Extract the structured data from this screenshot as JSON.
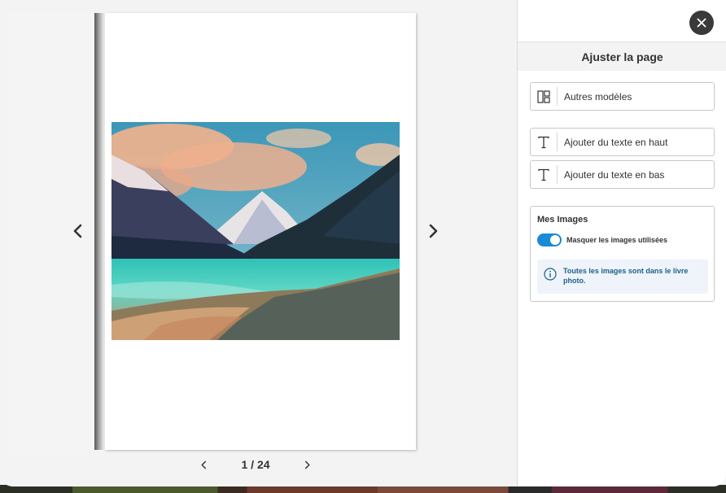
{
  "pager": {
    "current": "1",
    "total": "24",
    "separator": "/"
  },
  "sidebar": {
    "title": "Ajuster la page",
    "options": [
      {
        "label": "Autres modèles",
        "icon": "layout-icon"
      },
      {
        "label": "Ajouter du texte en haut",
        "icon": "text-icon"
      },
      {
        "label": "Ajouter du texte en bas",
        "icon": "text-icon"
      }
    ],
    "images": {
      "title": "Mes Images",
      "toggle_label": "Masquer les images utilisées",
      "toggle_on": true,
      "info_text": "Toutes les images sont dans le livre photo."
    }
  },
  "colors": {
    "accent": "#1a8ad4",
    "close_bg": "#3a3a3a",
    "info_bg": "#eef4fa",
    "info_text": "#1f5f8a"
  }
}
